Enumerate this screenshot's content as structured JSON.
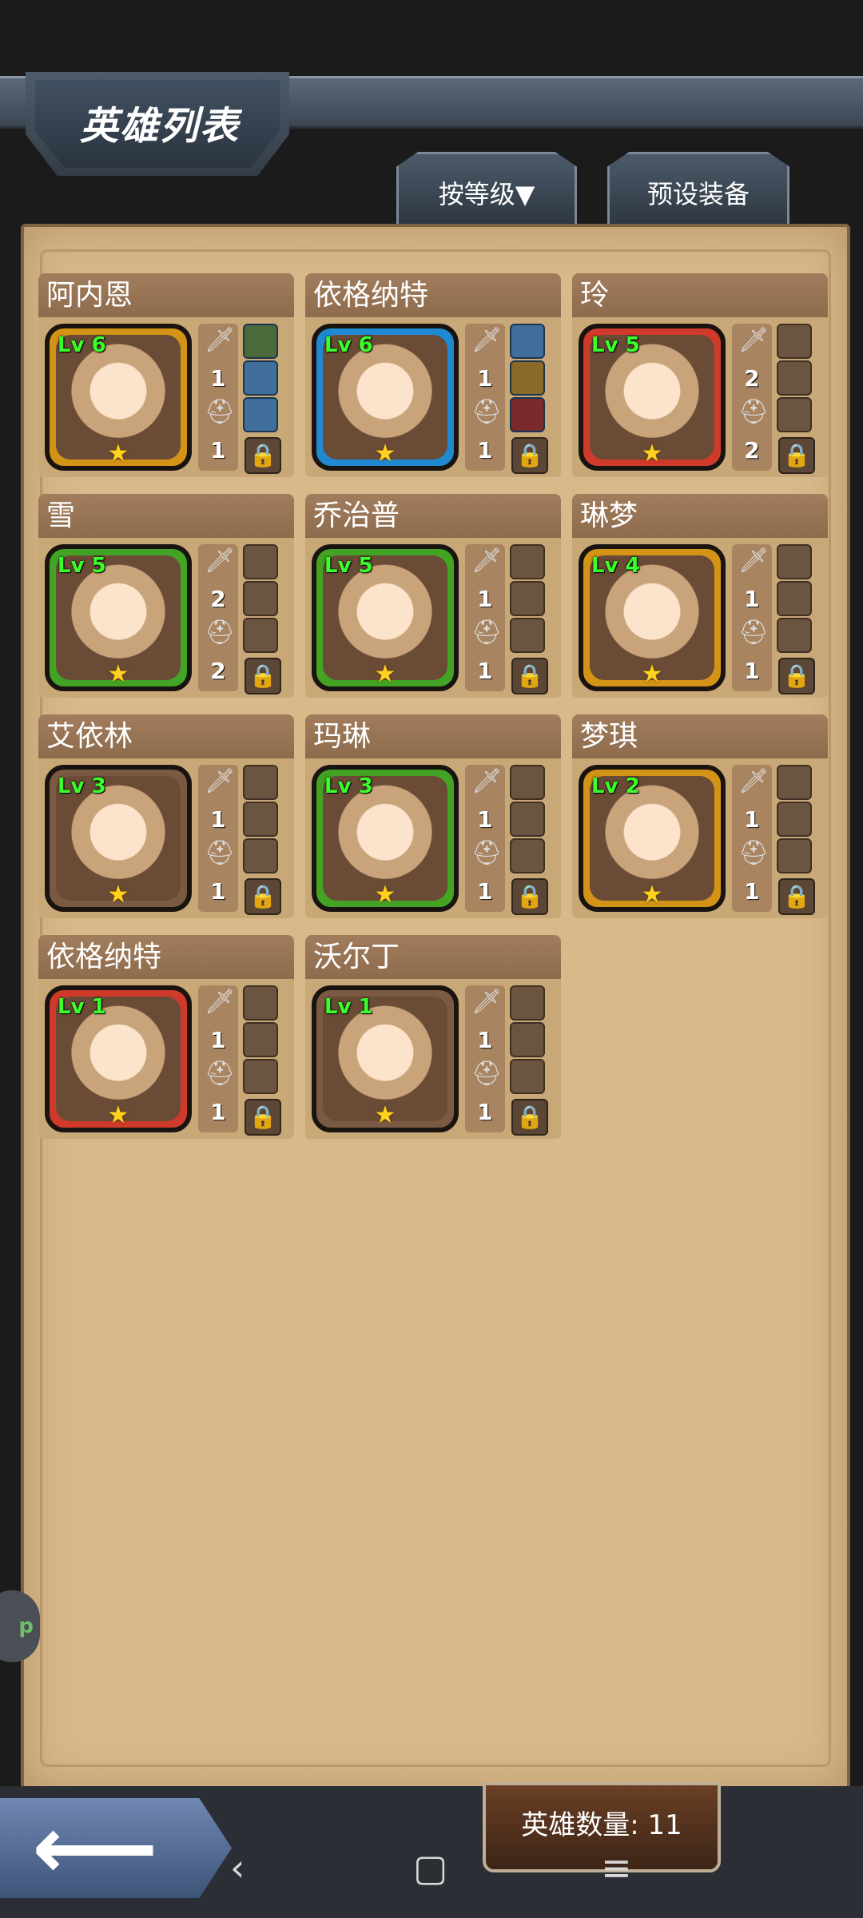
{
  "header": {
    "title": "英雄列表"
  },
  "tabs": {
    "sort_label": "按等级▼",
    "preset_label": "预设装备"
  },
  "heroes": [
    {
      "name": "阿内恩",
      "level": "Lv 6",
      "weapon": "1",
      "armor": "1",
      "frame": "#d39317",
      "slots": [
        "green",
        "blue",
        "purple"
      ]
    },
    {
      "name": "依格纳特",
      "level": "Lv 6",
      "weapon": "1",
      "armor": "1",
      "frame": "#1f8ad1",
      "slots": [
        "purple",
        "gold",
        "red"
      ]
    },
    {
      "name": "玲",
      "level": "Lv 5",
      "weapon": "2",
      "armor": "2",
      "frame": "#cf3a2a",
      "slots": []
    },
    {
      "name": "雪",
      "level": "Lv 5",
      "weapon": "2",
      "armor": "2",
      "frame": "#43a325",
      "slots": []
    },
    {
      "name": "乔治普",
      "level": "Lv 5",
      "weapon": "1",
      "armor": "1",
      "frame": "#43a325",
      "slots": []
    },
    {
      "name": "琳梦",
      "level": "Lv 4",
      "weapon": "1",
      "armor": "1",
      "frame": "#d39317",
      "slots": []
    },
    {
      "name": "艾依林",
      "level": "Lv 3",
      "weapon": "1",
      "armor": "1",
      "frame": "#7a5a43",
      "slots": []
    },
    {
      "name": "玛琳",
      "level": "Lv 3",
      "weapon": "1",
      "armor": "1",
      "frame": "#43a325",
      "slots": []
    },
    {
      "name": "梦琪",
      "level": "Lv 2",
      "weapon": "1",
      "armor": "1",
      "frame": "#d39317",
      "slots": []
    },
    {
      "name": "依格纳特",
      "level": "Lv 1",
      "weapon": "1",
      "armor": "1",
      "frame": "#cf3a2a",
      "slots": []
    },
    {
      "name": "沃尔丁",
      "level": "Lv 1",
      "weapon": "1",
      "armor": "1",
      "frame": "#7a5a43",
      "slots": []
    }
  ],
  "footer": {
    "hero_count": "英雄数量: 11",
    "side_bubble": "p"
  },
  "icons": {
    "weapon": "sword-icon",
    "armor": "helmet-icon",
    "lock": "lock-icon",
    "back": "back-arrow-icon",
    "star": "star-icon"
  }
}
